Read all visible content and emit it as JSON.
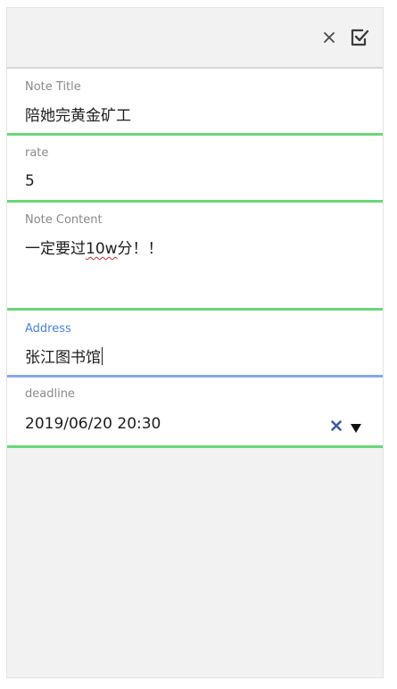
{
  "toolbar": {
    "close_icon": "close-icon",
    "save_icon": "checkbox-check-icon"
  },
  "form": {
    "title": {
      "label": "Note Title",
      "value": "陪她完黄金矿工"
    },
    "rate": {
      "label": "rate",
      "value": "5"
    },
    "content": {
      "label": "Note Content",
      "value_prefix": "一定要过",
      "value_marked": "10w",
      "value_suffix": "分！！"
    },
    "address": {
      "label": "Address",
      "value": "张江图书馆"
    },
    "deadline": {
      "label": "deadline",
      "value": "2019/06/20 20:30",
      "clear_icon": "clear-x-icon",
      "dropdown_icon": "triangle-down-icon"
    }
  },
  "colors": {
    "field_underline": "#6ad878",
    "active_underline": "#86a8ee",
    "active_label": "#4a7fe6",
    "clear_icon": "#3a5da8"
  }
}
